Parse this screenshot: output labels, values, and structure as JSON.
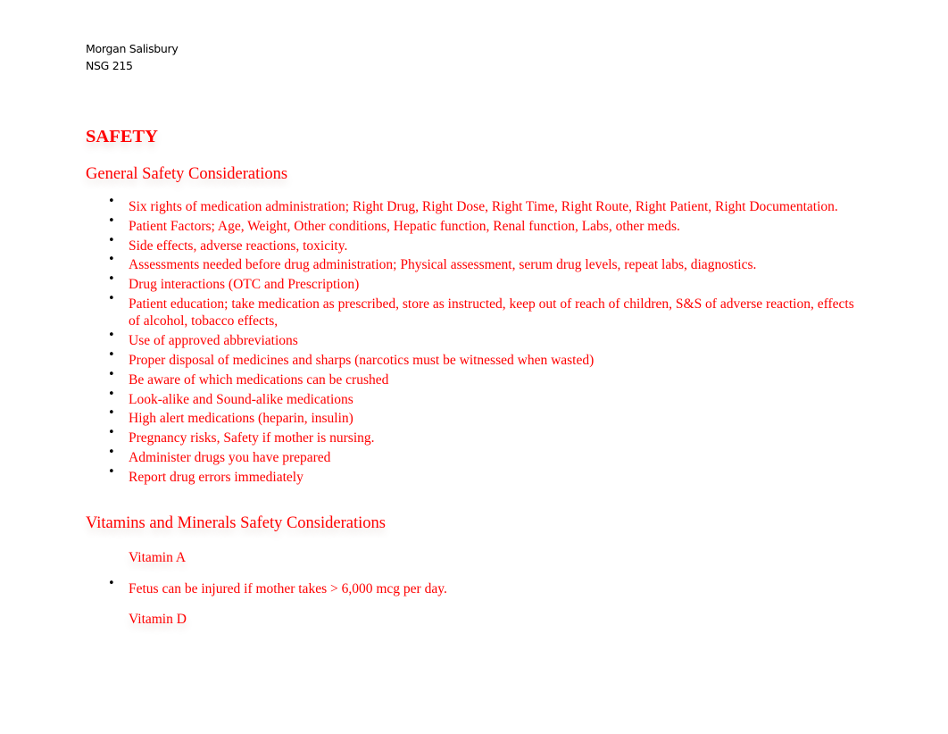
{
  "header": {
    "author": "Morgan Salisbury",
    "course": "NSG 215"
  },
  "colors": {
    "accent": "#ff0000",
    "body_text": "#000000",
    "background": "#ffffff"
  },
  "document": {
    "title": "SAFETY",
    "sections": [
      {
        "heading": "General Safety Considerations",
        "items": [
          "Six rights of medication administration; Right Drug, Right Dose, Right Time, Right Route,  Right Patient, Right Documentation.",
          "Patient Factors; Age, Weight, Other conditions, Hepatic function, Renal function, Labs, other meds.",
          "Side effects, adverse reactions, toxicity.",
          "Assessments needed before drug administration; Physical assessment, serum drug levels, repeat labs, diagnostics.",
          "Drug interactions (OTC and Prescription)",
          "Patient education; take medication as prescribed, store as instructed, keep out of reach of children, S&S of adverse reaction, effects of alcohol, tobacco effects,",
          "Use of approved abbreviations",
          "Proper disposal of medicines and sharps (narcotics must be witnessed when wasted)",
          "Be aware of which medications can be crushed",
          "Look-alike and Sound-alike medications",
          "High alert medications (heparin, insulin)",
          "Pregnancy risks, Safety if mother is nursing.",
          "Administer drugs you have prepared",
          "Report drug errors immediately"
        ]
      },
      {
        "heading": "Vitamins and Minerals Safety Considerations",
        "subsections": [
          {
            "label": "Vitamin A",
            "items": [
              "Fetus can be injured if mother takes > 6,000 mcg per day."
            ]
          },
          {
            "label": "Vitamin D",
            "items": []
          }
        ]
      }
    ]
  },
  "icons": {
    "bullet": "•"
  }
}
